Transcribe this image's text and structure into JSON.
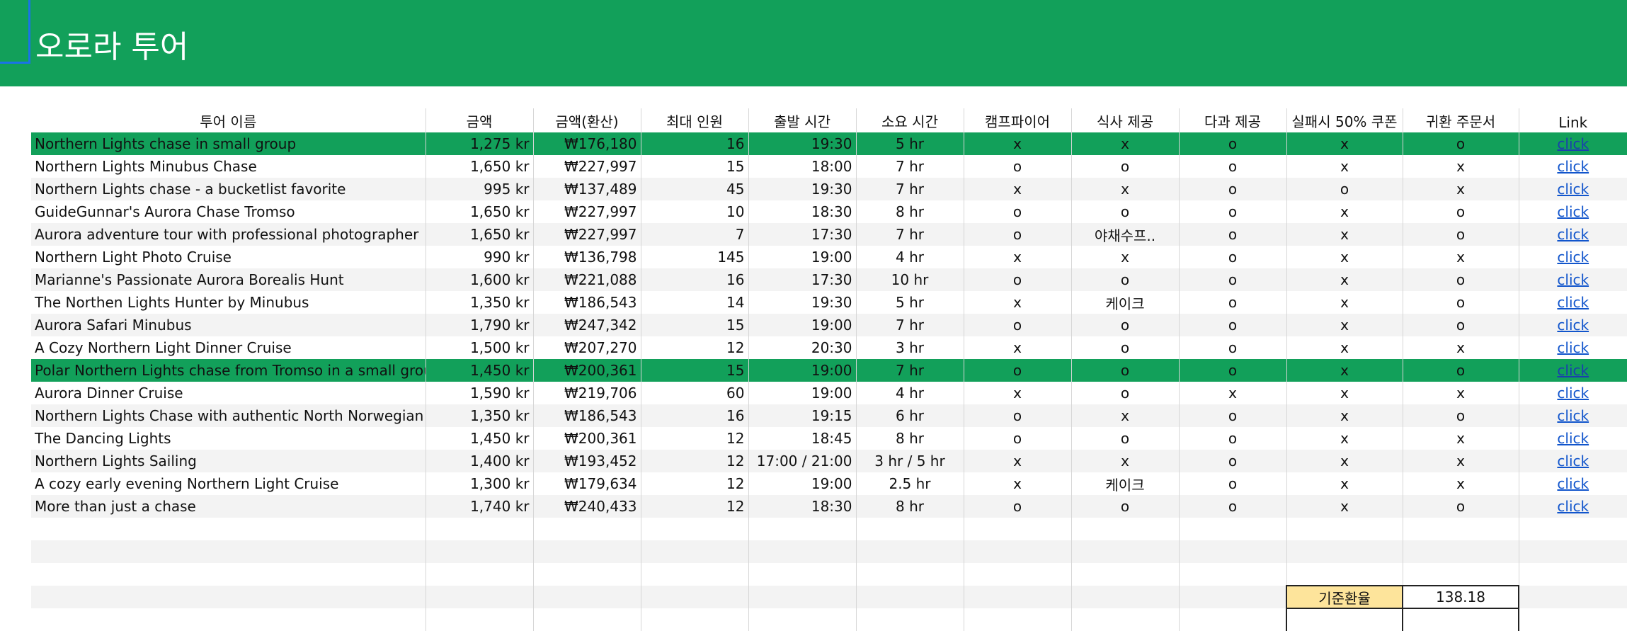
{
  "sheet_title": "오로라 투어",
  "columns": [
    "투어 이름",
    "금액",
    "금액(환산)",
    "최대 인원",
    "출발 시간",
    "소요 시간",
    "캠프파이어",
    "식사 제공",
    "다과 제공",
    "실패시 50% 쿠폰",
    "귀환 주문서",
    "Link"
  ],
  "colors": {
    "header_green": "#12a05a",
    "highlight_green": "#12a05a",
    "rate_label_bg": "#fde49b",
    "link": "#1155cc"
  },
  "rows": [
    {
      "name": "Northern Lights chase in small group",
      "price": "1,275 kr",
      "krw": "₩176,180",
      "max": "16",
      "depart": "19:30",
      "duration": "5 hr",
      "campfire": "x",
      "meal": "x",
      "snack": "o",
      "coupon": "x",
      "return": "o",
      "link": "click",
      "highlight": true
    },
    {
      "name": "Northern Lights Minubus Chase",
      "price": "1,650 kr",
      "krw": "₩227,997",
      "max": "15",
      "depart": "18:00",
      "duration": "7 hr",
      "campfire": "o",
      "meal": "o",
      "snack": "o",
      "coupon": "x",
      "return": "x",
      "link": "click",
      "highlight": false
    },
    {
      "name": "Northern Lights chase - a bucketlist favorite",
      "price": "995 kr",
      "krw": "₩137,489",
      "max": "45",
      "depart": "19:30",
      "duration": "7 hr",
      "campfire": "x",
      "meal": "x",
      "snack": "o",
      "coupon": "o",
      "return": "x",
      "link": "click",
      "highlight": false
    },
    {
      "name": "GuideGunnar's Aurora Chase Tromso",
      "price": "1,650 kr",
      "krw": "₩227,997",
      "max": "10",
      "depart": "18:30",
      "duration": "8 hr",
      "campfire": "o",
      "meal": "o",
      "snack": "o",
      "coupon": "x",
      "return": "o",
      "link": "click",
      "highlight": false
    },
    {
      "name": "Aurora adventure tour with professional photographer",
      "price": "1,650 kr",
      "krw": "₩227,997",
      "max": "7",
      "depart": "17:30",
      "duration": "7 hr",
      "campfire": "o",
      "meal": "야채수프..",
      "snack": "o",
      "coupon": "x",
      "return": "o",
      "link": "click",
      "highlight": false
    },
    {
      "name": "Northern Light Photo Cruise",
      "price": "990 kr",
      "krw": "₩136,798",
      "max": "145",
      "depart": "19:00",
      "duration": "4 hr",
      "campfire": "x",
      "meal": "x",
      "snack": "o",
      "coupon": "x",
      "return": "x",
      "link": "click",
      "highlight": false
    },
    {
      "name": "Marianne's Passionate Aurora Borealis Hunt",
      "price": "1,600 kr",
      "krw": "₩221,088",
      "max": "16",
      "depart": "17:30",
      "duration": "10 hr",
      "campfire": "o",
      "meal": "o",
      "snack": "o",
      "coupon": "x",
      "return": "o",
      "link": "click",
      "highlight": false
    },
    {
      "name": "The Northen Lights Hunter by Minubus",
      "price": "1,350 kr",
      "krw": "₩186,543",
      "max": "14",
      "depart": "19:30",
      "duration": "5 hr",
      "campfire": "x",
      "meal": "케이크",
      "snack": "o",
      "coupon": "x",
      "return": "o",
      "link": "click",
      "highlight": false
    },
    {
      "name": "Aurora Safari Minubus",
      "price": "1,790 kr",
      "krw": "₩247,342",
      "max": "15",
      "depart": "19:00",
      "duration": "7 hr",
      "campfire": "o",
      "meal": "o",
      "snack": "o",
      "coupon": "x",
      "return": "o",
      "link": "click",
      "highlight": false
    },
    {
      "name": "A Cozy Northern Light Dinner Cruise",
      "price": "1,500 kr",
      "krw": "₩207,270",
      "max": "12",
      "depart": "20:30",
      "duration": "3 hr",
      "campfire": "x",
      "meal": "o",
      "snack": "o",
      "coupon": "x",
      "return": "x",
      "link": "click",
      "highlight": false
    },
    {
      "name": "Polar Northern Lights chase from Tromso in a small group",
      "price": "1,450 kr",
      "krw": "₩200,361",
      "max": "15",
      "depart": "19:00",
      "duration": "7 hr",
      "campfire": "o",
      "meal": "o",
      "snack": "o",
      "coupon": "x",
      "return": "o",
      "link": "click",
      "highlight": true
    },
    {
      "name": "Aurora Dinner Cruise",
      "price": "1,590 kr",
      "krw": "₩219,706",
      "max": "60",
      "depart": "19:00",
      "duration": "4 hr",
      "campfire": "x",
      "meal": "o",
      "snack": "x",
      "coupon": "x",
      "return": "x",
      "link": "click",
      "highlight": false
    },
    {
      "name": "Northern Lights Chase with authentic North Norwegian charm",
      "price": "1,350 kr",
      "krw": "₩186,543",
      "max": "16",
      "depart": "19:15",
      "duration": "6 hr",
      "campfire": "o",
      "meal": "x",
      "snack": "o",
      "coupon": "x",
      "return": "o",
      "link": "click",
      "highlight": false
    },
    {
      "name": "The Dancing Lights",
      "price": "1,450 kr",
      "krw": "₩200,361",
      "max": "12",
      "depart": "18:45",
      "duration": "8 hr",
      "campfire": "o",
      "meal": "o",
      "snack": "o",
      "coupon": "x",
      "return": "x",
      "link": "click",
      "highlight": false
    },
    {
      "name": "Northern Lights Sailing",
      "price": "1,400 kr",
      "krw": "₩193,452",
      "max": "12",
      "depart": "17:00 / 21:00",
      "duration": "3 hr / 5 hr",
      "campfire": "x",
      "meal": "x",
      "snack": "o",
      "coupon": "x",
      "return": "x",
      "link": "click",
      "highlight": false
    },
    {
      "name": "A cozy early evening Northern Light Cruise",
      "price": "1,300 kr",
      "krw": "₩179,634",
      "max": "12",
      "depart": "19:00",
      "duration": "2.5 hr",
      "campfire": "x",
      "meal": "케이크",
      "snack": "o",
      "coupon": "x",
      "return": "x",
      "link": "click",
      "highlight": false
    },
    {
      "name": "More than just a chase",
      "price": "1,740 kr",
      "krw": "₩240,433",
      "max": "12",
      "depart": "18:30",
      "duration": "8 hr",
      "campfire": "o",
      "meal": "o",
      "snack": "o",
      "coupon": "x",
      "return": "o",
      "link": "click",
      "highlight": false
    }
  ],
  "exchange_rate": {
    "label": "기준환율",
    "value": "138.18"
  }
}
